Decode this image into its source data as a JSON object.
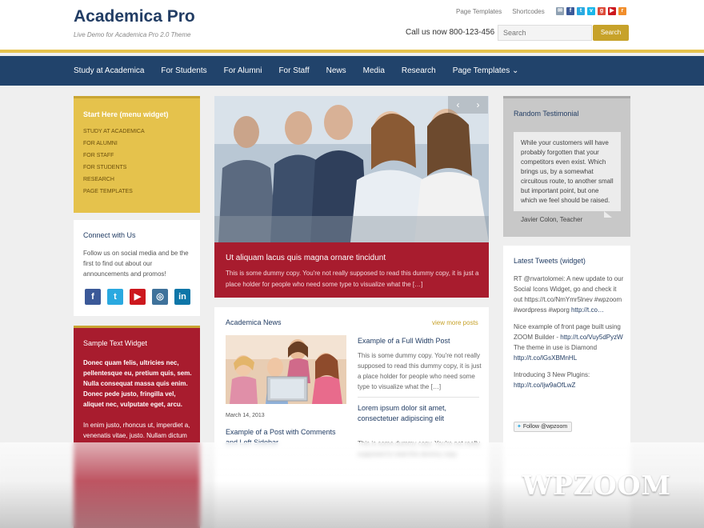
{
  "header": {
    "site_title": "Academica Pro",
    "tagline": "Live Demo for Academica Pro 2.0 Theme",
    "top_links": [
      "Page Templates",
      "Shortcodes"
    ],
    "social_icons": [
      {
        "icon": "mail-icon",
        "color": "#8fa1b3",
        "glyph": "✉"
      },
      {
        "icon": "facebook-icon",
        "color": "#3b5998",
        "glyph": "f"
      },
      {
        "icon": "twitter-icon",
        "color": "#2aa9e0",
        "glyph": "t"
      },
      {
        "icon": "vimeo-icon",
        "color": "#1ab7ea",
        "glyph": "v"
      },
      {
        "icon": "google-plus-icon",
        "color": "#dd4b39",
        "glyph": "g"
      },
      {
        "icon": "youtube-icon",
        "color": "#cc181e",
        "glyph": "▶"
      },
      {
        "icon": "rss-icon",
        "color": "#f18e2b",
        "glyph": "r"
      }
    ],
    "call_text": "Call us now 800-123-456",
    "search_placeholder": "Search",
    "search_button": "Search"
  },
  "nav": {
    "items": [
      "Study at Academica",
      "For Students",
      "For Alumni",
      "For Staff",
      "News",
      "Media",
      "Research",
      "Page Templates ⌄"
    ]
  },
  "sidebar_left": {
    "start_widget": {
      "title": "Start Here (menu widget)",
      "links": [
        "STUDY AT ACADEMICA",
        "FOR ALUMNI",
        "FOR STAFF",
        "FOR STUDENTS",
        "RESEARCH",
        "PAGE TEMPLATES"
      ]
    },
    "connect_widget": {
      "title": "Connect with Us",
      "text": "Follow us on social media and be the first to find out about our announcements and promos!",
      "buttons": [
        {
          "icon": "facebook-icon",
          "color": "#3b5998",
          "glyph": "f"
        },
        {
          "icon": "twitter-icon",
          "color": "#2aa9e0",
          "glyph": "t"
        },
        {
          "icon": "youtube-icon",
          "color": "#cc181e",
          "glyph": "▶"
        },
        {
          "icon": "instagram-icon",
          "color": "#3f729b",
          "glyph": "◎"
        },
        {
          "icon": "linkedin-icon",
          "color": "#0e76a8",
          "glyph": "in"
        }
      ]
    },
    "sample_widget": {
      "title": "Sample Text Widget",
      "bold_text": "Donec quam felis, ultricies nec, pellentesque eu, pretium quis, sem. Nulla consequat massa quis enim. Donec pede justo, fringilla vel, aliquet nec, vulputate eget, arcu.",
      "text": "In enim justo, rhoncus ut, imperdiet a, venenatis vitae, justo. Nullam dictum"
    }
  },
  "slider": {
    "title": "Ut aliquam lacus quis magna ornare tincidunt",
    "text": "This is some dummy copy. You're not really supposed to read this dummy copy, it is just a place holder for people who need some type to visualize what the […]",
    "prev": "‹",
    "next": "›"
  },
  "news": {
    "title": "Academica News",
    "view_more": "view more posts",
    "featured": {
      "date": "March 14, 2013",
      "title": "Example of a Post with Comments and Left Sidebar"
    },
    "posts": [
      {
        "title": "Example of a Full Width Post",
        "text": "This is some dummy copy. You're not really supposed to read this dummy copy, it is just a place holder for people who need some type to visualize what the […]"
      },
      {
        "title": "Lorem ipsum dolor sit amet, consectetuer adipiscing elit",
        "text": "This is some dummy copy. You're not really supposed to read this dummy copy"
      }
    ]
  },
  "sidebar_right": {
    "testimonial": {
      "title": "Random Testimonial",
      "quote": "While your customers will have probably forgotten that your competitors even exist. Which brings us, by a somewhat circuitous route, to another small but important point, but one which we feel should be raised.",
      "author": "Javier Colon, Teacher"
    },
    "tweets": {
      "title": "Latest Tweets (widget)",
      "items": [
        {
          "text": "RT @nvartolomei: A new update to our Social Icons Widget, go and check it out https://t.co/NmYmr5lnev #wpzoom #wordpress #wporg",
          "link": "http://t.co…"
        },
        {
          "text": "Nice example of front page built using ZOOM Builder -",
          "link": "http://t.co/Vuy5dPyzW",
          "after": "The theme in use is Diamond",
          "link2": "http://t.co/lGsXBMnHL"
        },
        {
          "text": "Introducing 3 New Plugins:",
          "link": "http://t.co/Ijw9aOfLwZ"
        }
      ],
      "follow_button": "Follow @wpzoom"
    }
  },
  "brand_overlay": {
    "logo_text": "WPZOOM"
  }
}
